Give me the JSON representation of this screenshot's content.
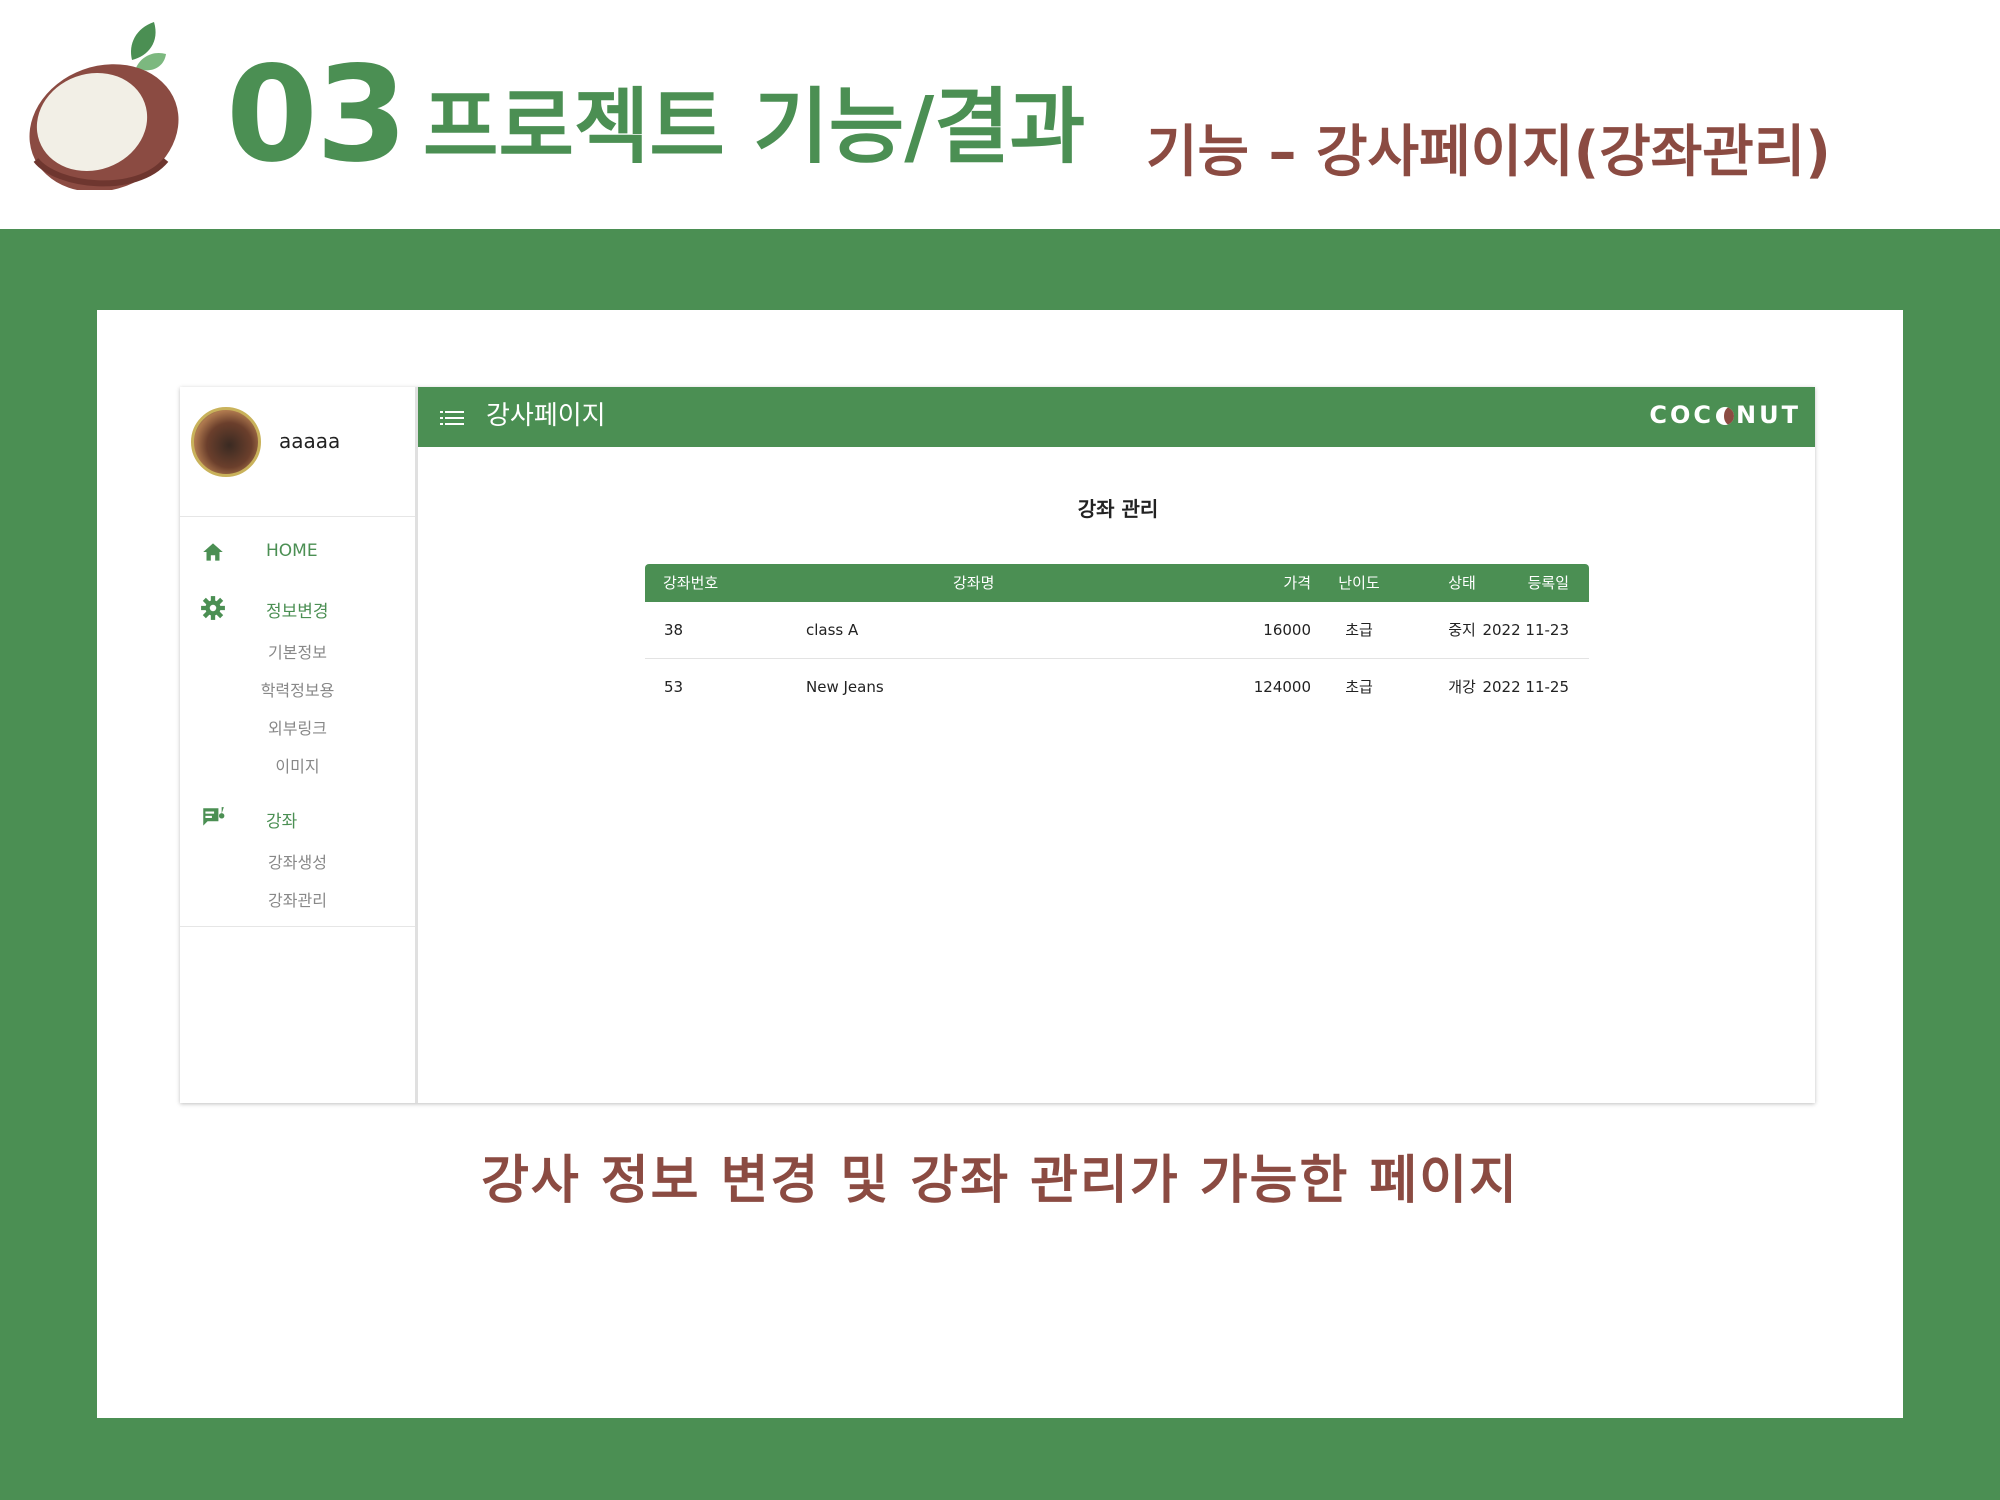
{
  "slide": {
    "section_number": "03",
    "section_title": "프로젝트 기능/결과",
    "subtitle": "기능 –  강사페이지(강좌관리)",
    "caption": "강사 정보 변경 및 강좌 관리가 가능한 페이지"
  },
  "colors": {
    "brand_green": "#4b8f53",
    "brand_brown": "#8b4b42"
  },
  "app": {
    "topbar": {
      "title": "강사페이지",
      "brand_left": "COC",
      "brand_right": "NUT",
      "menu_icon": "menu-list-icon"
    },
    "profile": {
      "username": "aaaaa"
    },
    "nav": {
      "home": "HOME",
      "info_change": "정보변경",
      "info_subitems": [
        "기본정보",
        "학력정보용",
        "외부링크",
        "이미지"
      ],
      "course": "강좌",
      "course_subitems": [
        "강좌생성",
        "강좌관리"
      ]
    },
    "content": {
      "title": "강좌 관리",
      "table": {
        "headers": [
          "강좌번호",
          "강좌명",
          "가격",
          "난이도",
          "상태",
          "등록일"
        ],
        "rows": [
          [
            "38",
            "class A",
            "16000",
            "초급",
            "중지",
            "2022 11-23"
          ],
          [
            "53",
            "New Jeans",
            "124000",
            "초급",
            "개강",
            "2022 11-25"
          ]
        ]
      }
    }
  }
}
